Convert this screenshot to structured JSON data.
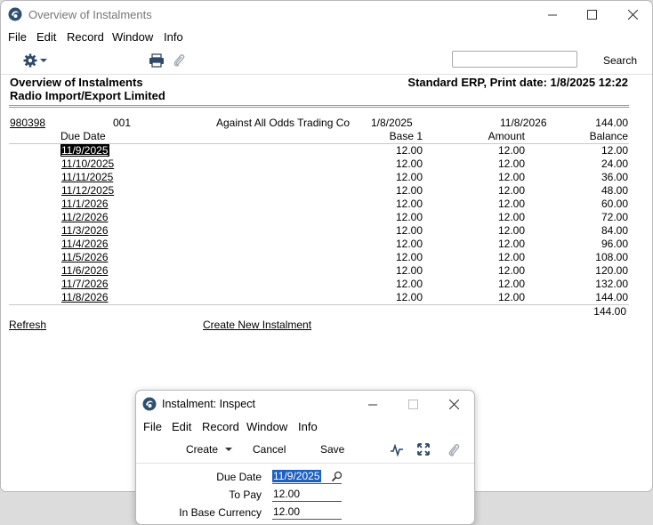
{
  "main": {
    "title": "Overview of Instalments",
    "menu": [
      "File",
      "Edit",
      "Record",
      "Window",
      "Info"
    ],
    "search_label": "Search",
    "search_value": "",
    "report_title": "Overview of Instalments",
    "company": "Radio Import/Export Limited",
    "print_info": "Standard ERP, Print date: 1/8/2025 12:22",
    "record": {
      "number": "980398",
      "code": "001",
      "customer": "Against All Odds Trading Co",
      "start_date": "1/8/2025",
      "end_date": "11/8/2026",
      "total": "144.00"
    },
    "columns": {
      "due_date": "Due Date",
      "base": "Base 1",
      "amount": "Amount",
      "balance": "Balance"
    },
    "rows": [
      {
        "due": "11/9/2025",
        "base": "12.00",
        "amount": "12.00",
        "balance": "12.00"
      },
      {
        "due": "11/10/2025",
        "base": "12.00",
        "amount": "12.00",
        "balance": "24.00"
      },
      {
        "due": "11/11/2025",
        "base": "12.00",
        "amount": "12.00",
        "balance": "36.00"
      },
      {
        "due": "11/12/2025",
        "base": "12.00",
        "amount": "12.00",
        "balance": "48.00"
      },
      {
        "due": "11/1/2026",
        "base": "12.00",
        "amount": "12.00",
        "balance": "60.00"
      },
      {
        "due": "11/2/2026",
        "base": "12.00",
        "amount": "12.00",
        "balance": "72.00"
      },
      {
        "due": "11/3/2026",
        "base": "12.00",
        "amount": "12.00",
        "balance": "84.00"
      },
      {
        "due": "11/4/2026",
        "base": "12.00",
        "amount": "12.00",
        "balance": "96.00"
      },
      {
        "due": "11/5/2026",
        "base": "12.00",
        "amount": "12.00",
        "balance": "108.00"
      },
      {
        "due": "11/6/2026",
        "base": "12.00",
        "amount": "12.00",
        "balance": "120.00"
      },
      {
        "due": "11/7/2026",
        "base": "12.00",
        "amount": "12.00",
        "balance": "132.00"
      },
      {
        "due": "11/8/2026",
        "base": "12.00",
        "amount": "12.00",
        "balance": "144.00"
      }
    ],
    "grand_total": "144.00",
    "refresh_link": "Refresh",
    "create_link": "Create New Instalment"
  },
  "dialog": {
    "title": "Instalment: Inspect",
    "menu": [
      "File",
      "Edit",
      "Record",
      "Window",
      "Info"
    ],
    "create_label": "Create",
    "cancel_label": "Cancel",
    "save_label": "Save",
    "fields": {
      "due_date_label": "Due Date",
      "due_date_value": "11/9/2025",
      "to_pay_label": "To Pay",
      "to_pay_value": "12.00",
      "base_label": "In Base Currency",
      "base_value": "12.00"
    }
  },
  "colors": {
    "selection": "#1e5fbf",
    "row_selection": "#000000"
  }
}
